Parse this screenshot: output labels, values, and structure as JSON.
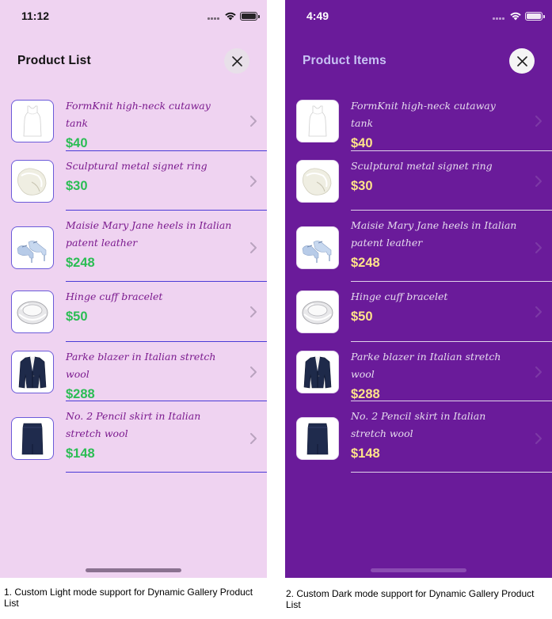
{
  "light": {
    "status_time": "11:12",
    "title": "Product List",
    "colors": {
      "background": "#efd3f1",
      "title": "#111111",
      "product_name": "#7b1a8e",
      "price": "#2bbd54",
      "divider": "#4a3bd6",
      "thumb_border": "#6b5bd9",
      "chevron": "#b9a3bf",
      "close_bg": "#e8e0e9",
      "close_icon": "#222222",
      "status": "#111111",
      "home_indicator": "#8a7190"
    }
  },
  "dark": {
    "status_time": "4:49",
    "title": "Product Items",
    "colors": {
      "background": "#6a1b9a",
      "title": "#c8c3f4",
      "product_name": "#e6dcee",
      "price": "#ffe38a",
      "divider": "#e0d2ea",
      "thumb_border": "#e3d6ec",
      "chevron": "#7d3aa6",
      "close_bg": "#f5f5f5",
      "close_icon": "#222222",
      "status": "#ffffff",
      "home_indicator": "#8b4cb2"
    }
  },
  "products": [
    {
      "name": "FormKnit high-neck cutaway tank",
      "price": "$40",
      "icon": "tank-top-icon"
    },
    {
      "name": "Sculptural metal signet ring",
      "price": "$30",
      "icon": "ring-icon"
    },
    {
      "name": "Maisie Mary Jane heels in Italian patent leather",
      "price": "$248",
      "icon": "heels-icon"
    },
    {
      "name": "Hinge cuff bracelet",
      "price": "$50",
      "icon": "bracelet-icon"
    },
    {
      "name": "Parke blazer in Italian stretch wool",
      "price": "$288",
      "icon": "blazer-icon"
    },
    {
      "name": "No. 2 Pencil skirt in Italian stretch wool",
      "price": "$148",
      "icon": "skirt-icon"
    }
  ],
  "captions": {
    "light": "1. Custom Light mode support for Dynamic Gallery Product List",
    "dark": "2. Custom Dark mode support for Dynamic Gallery Product List"
  }
}
